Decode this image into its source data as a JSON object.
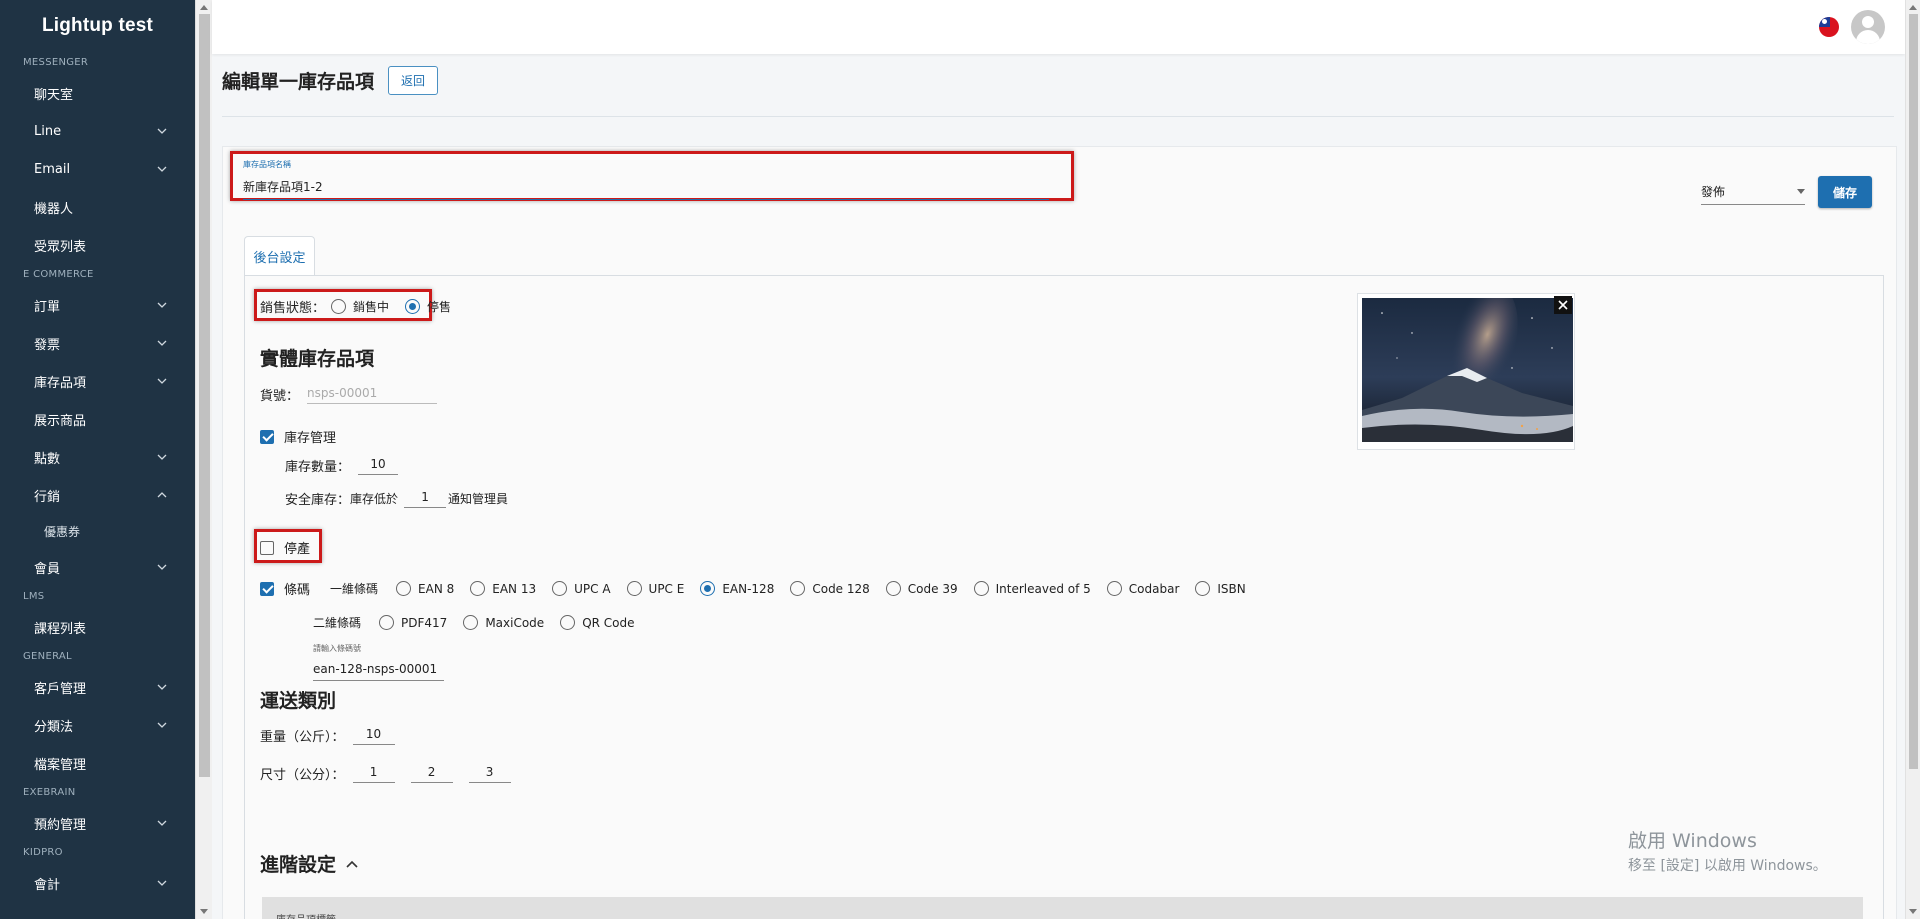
{
  "sidebar": {
    "title": "Lightup test",
    "sections": [
      {
        "label": "MESSENGER",
        "items": [
          {
            "label": "聊天室",
            "chevron": "none"
          },
          {
            "label": "Line",
            "chevron": "down"
          },
          {
            "label": "Email",
            "chevron": "down"
          },
          {
            "label": "機器人",
            "chevron": "none"
          },
          {
            "label": "受眾列表",
            "chevron": "none"
          }
        ]
      },
      {
        "label": "E COMMERCE",
        "items": [
          {
            "label": "訂單",
            "chevron": "down"
          },
          {
            "label": "發票",
            "chevron": "down"
          },
          {
            "label": "庫存品項",
            "chevron": "down"
          },
          {
            "label": "展示商品",
            "chevron": "none"
          },
          {
            "label": "點數",
            "chevron": "down"
          },
          {
            "label": "行銷",
            "chevron": "up"
          },
          {
            "label": "優惠券",
            "chevron": "none",
            "sub": true
          },
          {
            "label": "會員",
            "chevron": "down"
          }
        ]
      },
      {
        "label": "LMS",
        "items": [
          {
            "label": "課程列表",
            "chevron": "none"
          }
        ]
      },
      {
        "label": "GENERAL",
        "items": [
          {
            "label": "客戶管理",
            "chevron": "down"
          },
          {
            "label": "分類法",
            "chevron": "down"
          },
          {
            "label": "檔案管理",
            "chevron": "none"
          }
        ]
      },
      {
        "label": "EXEBRAIN",
        "items": [
          {
            "label": "預約管理",
            "chevron": "down"
          }
        ]
      },
      {
        "label": "KIDPRO",
        "items": [
          {
            "label": "會計",
            "chevron": "down"
          }
        ]
      }
    ]
  },
  "header": {
    "title": "編輯單一庫存品項",
    "back_label": "返回"
  },
  "form": {
    "name_label": "庫存品項名稱",
    "name_value": "新庫存品項1-2",
    "publish_value": "發佈",
    "save_label": "儲存",
    "tab_label": "後台設定",
    "sale_status": {
      "label": "銷售狀態：",
      "options": [
        "銷售中",
        "停售"
      ],
      "selected": "停售"
    },
    "physical_title": "實體庫存品項",
    "sku": {
      "label": "貨號：",
      "placeholder": "nsps-00001"
    },
    "inventory": {
      "label": "庫存管理",
      "checked": true,
      "qty_label": "庫存數量：",
      "qty_value": "10",
      "safety_label": "安全庫存：",
      "safety_prefix": "庫存低於",
      "safety_value": "1",
      "safety_suffix": "通知管理員"
    },
    "discontinued": {
      "label": "停產",
      "checked": false
    },
    "barcode": {
      "label": "條碼",
      "checked": true,
      "one_d_label": "一維條碼",
      "one_d_options": [
        "EAN 8",
        "EAN 13",
        "UPC A",
        "UPC E",
        "EAN-128",
        "Code 128",
        "Code 39",
        "Interleaved of 5",
        "Codabar",
        "ISBN"
      ],
      "one_d_selected": "EAN-128",
      "two_d_label": "二維條碼",
      "two_d_options": [
        "PDF417",
        "MaxiCode",
        "QR Code"
      ],
      "input_label": "請輸入條碼號",
      "input_value": "ean-128-nsps-00001"
    },
    "shipping_title": "運送類別",
    "weight": {
      "label": "重量（公斤）：",
      "value": "10"
    },
    "size": {
      "label": "尺寸（公分）：",
      "values": [
        "1",
        "2",
        "3"
      ]
    },
    "advanced_title": "進階設定",
    "advanced_bar_label": "庫存品項標籤"
  },
  "watermark": {
    "line1": "啟用 Windows",
    "line2": "移至 [設定] 以啟用 Windows。"
  },
  "colors": {
    "sidebar_bg": "#1f3344",
    "accent": "#1e6fb0",
    "highlight": "#cc1a1a"
  }
}
